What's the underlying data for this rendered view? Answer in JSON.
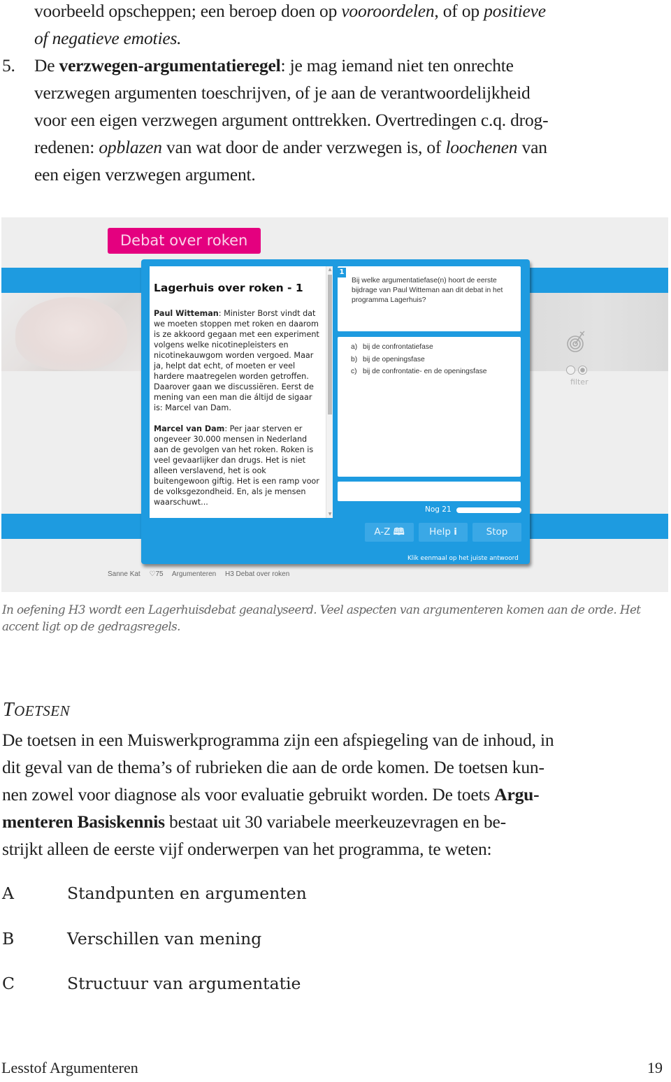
{
  "intro": {
    "line1_pre": "voorbeeld opscheppen; een beroep doen op ",
    "line1_em1": "vooroordelen",
    "line1_mid": ", of op ",
    "line1_em2": "positieve",
    "line2_em": "of negatieve emoties.",
    "item_number": "5.",
    "item_pre": "De ",
    "item_bold": "verzwegen-argumentatieregel",
    "item_line1_rest": ": je mag iemand niet ten onrechte",
    "item_line2": "verzwegen argumenten toeschrijven, of je aan de verantwoordelijkheid",
    "item_line3": "voor een eigen verzwegen argument onttrekken. Overtredingen c.q. drog-",
    "item_line4_pre": "redenen: ",
    "item_line4_em1": "opblazen",
    "item_line4_mid": " van wat door de ander verzwegen is, of ",
    "item_line4_em2": "loochenen",
    "item_line4_post": " van",
    "item_line5": "een eigen verzwegen argument."
  },
  "screenshot": {
    "app_title": "Debat over roken",
    "text_panel": {
      "heading": "Lagerhuis over roken - 1",
      "paragraphs": [
        {
          "speaker": "Paul Witteman",
          "text": ": Minister Borst vindt dat we moeten stoppen met roken en daarom is ze akkoord gegaan met een experiment volgens welke nicotinepleisters en nicotinekauwgom worden vergoed. Maar ja, helpt dat echt, of moeten er veel hardere maatregelen worden getroffen. Daarover gaan we discussiëren. Eerst de mening van een man die áltijd de sigaar is: Marcel van Dam."
        },
        {
          "speaker": "Marcel van Dam",
          "text": ": Per jaar sterven er ongeveer 30.000 mensen in Nederland aan de gevolgen van het roken. Roken is veel gevaarlijker dan drugs. Het is niet alleen verslavend, het is ook buitengewoon giftig. Het is een ramp voor de volksgezondheid. En, als je mensen waarschuwt..."
        }
      ]
    },
    "question": {
      "number": "1",
      "text": "Bij welke argumentatiefase(n) hoort de eerste bijdrage van Paul Witteman aan dit debat in het programma Lagerhuis?",
      "answers": [
        {
          "label": "a)",
          "text": "bij de confrontatiefase"
        },
        {
          "label": "b)",
          "text": "bij de openingsfase"
        },
        {
          "label": "c)",
          "text": "bij de confrontatie- en de openingsfase"
        }
      ],
      "answer_input_value": ""
    },
    "progress": {
      "label": "Nog 21",
      "remaining": 21,
      "fraction_remaining": 1.0
    },
    "buttons": {
      "az": "A-Z",
      "az_icon": "book-icon",
      "help": "Help",
      "help_icon": "info-icon",
      "stop": "Stop"
    },
    "hint": "Klik eenmaal op het juiste antwoord",
    "filter_label": "filter",
    "breadcrumb": [
      "Sanne Kat",
      "♡75",
      "Argumenteren",
      "H3 Debat over roken"
    ],
    "colors": {
      "brand_blue": "#1e9be0",
      "title_pink": "#e4007f"
    }
  },
  "caption": "In oefening H3 wordt een Lagerhuisdebat geanalyseerd. Veel aspecten van argumenteren komen aan de orde. Het accent ligt op de gedragsregels.",
  "toetsen": {
    "title_first": "T",
    "title_rest": "OETSEN",
    "line1": "De toetsen in een Muiswerkprogramma zijn een afspiegeling van de inhoud, in",
    "line2": "dit geval van de thema’s of rubrieken die aan de orde komen. De toetsen kun-",
    "line3_pre": "nen zowel voor diagnose als voor evaluatie gebruikt worden. De toets ",
    "line3_bold": "Argu-",
    "line4_bold": "menteren Basiskennis",
    "line4_rest": " bestaat uit 30 variabele meerkeuzevragen en be-",
    "line5": "strijkt alleen de eerste vijf onderwerpen van het programma, te weten:",
    "topics": [
      {
        "letter": "A",
        "text": "Standpunten en argumenten"
      },
      {
        "letter": "B",
        "text": "Verschillen van mening"
      },
      {
        "letter": "C",
        "text": "Structuur van argumentatie"
      }
    ]
  },
  "footer": {
    "title": "Lesstof Argumenteren",
    "page": "19"
  }
}
